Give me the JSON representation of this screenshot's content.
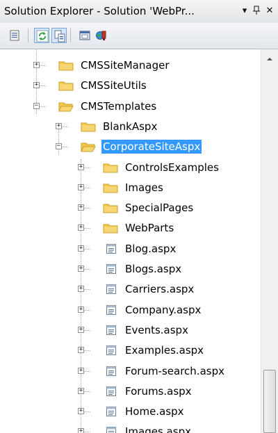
{
  "panel": {
    "title": "Solution Explorer - Solution 'WebPr...",
    "dropdown_icon": "dropdown-arrow-icon",
    "pin_icon": "pin-icon",
    "close_icon": "close-icon",
    "dropdown_glyph": "▾",
    "pin_glyph": "ᵖ",
    "close_glyph": "✕"
  },
  "toolbar": {
    "buttons": [
      {
        "name": "properties-button",
        "icon": "properties-icon",
        "active": false
      },
      {
        "name": "refresh-button",
        "icon": "refresh-icon",
        "active": true
      },
      {
        "name": "show-all-files-button",
        "icon": "show-all-files-icon",
        "active": true
      },
      {
        "name": "view-designer-button",
        "icon": "view-designer-icon",
        "active": false
      },
      {
        "name": "copy-website-button",
        "icon": "copy-website-icon",
        "active": false
      }
    ]
  },
  "tree": {
    "items": [
      {
        "label": "CMSSiteManager",
        "type": "folder",
        "level": 0,
        "expanded": false,
        "selected": false
      },
      {
        "label": "CMSSiteUtils",
        "type": "folder",
        "level": 0,
        "expanded": false,
        "selected": false
      },
      {
        "label": "CMSTemplates",
        "type": "folder",
        "level": 0,
        "expanded": true,
        "selected": false
      },
      {
        "label": "BlankAspx",
        "type": "folder",
        "level": 1,
        "expanded": false,
        "selected": false
      },
      {
        "label": "CorporateSiteAspx",
        "type": "folder",
        "level": 1,
        "expanded": true,
        "selected": true
      },
      {
        "label": "ControlsExamples",
        "type": "folder",
        "level": 2,
        "expanded": false,
        "selected": false
      },
      {
        "label": "Images",
        "type": "folder",
        "level": 2,
        "expanded": false,
        "selected": false
      },
      {
        "label": "SpecialPages",
        "type": "folder",
        "level": 2,
        "expanded": false,
        "selected": false
      },
      {
        "label": "WebParts",
        "type": "folder",
        "level": 2,
        "expanded": false,
        "selected": false
      },
      {
        "label": "Blog.aspx",
        "type": "file",
        "level": 2,
        "expanded": false,
        "selected": false
      },
      {
        "label": "Blogs.aspx",
        "type": "file",
        "level": 2,
        "expanded": false,
        "selected": false
      },
      {
        "label": "Carriers.aspx",
        "type": "file",
        "level": 2,
        "expanded": false,
        "selected": false
      },
      {
        "label": "Company.aspx",
        "type": "file",
        "level": 2,
        "expanded": false,
        "selected": false
      },
      {
        "label": "Events.aspx",
        "type": "file",
        "level": 2,
        "expanded": false,
        "selected": false
      },
      {
        "label": "Examples.aspx",
        "type": "file",
        "level": 2,
        "expanded": false,
        "selected": false
      },
      {
        "label": "Forum-search.aspx",
        "type": "file",
        "level": 2,
        "expanded": false,
        "selected": false
      },
      {
        "label": "Forums.aspx",
        "type": "file",
        "level": 2,
        "expanded": false,
        "selected": false
      },
      {
        "label": "Home.aspx",
        "type": "file",
        "level": 2,
        "expanded": false,
        "selected": false
      },
      {
        "label": "Images.aspx",
        "type": "file",
        "level": 2,
        "expanded": false,
        "selected": false
      }
    ],
    "expander_collapsed": "+",
    "expander_expanded": "−"
  },
  "scrollbar": {
    "up_icon": "scroll-up-arrow-icon",
    "thumb": "scroll-thumb"
  },
  "colors": {
    "selection": "#3399ff",
    "folder": "#f2c94c",
    "folder_border": "#c9a227"
  }
}
